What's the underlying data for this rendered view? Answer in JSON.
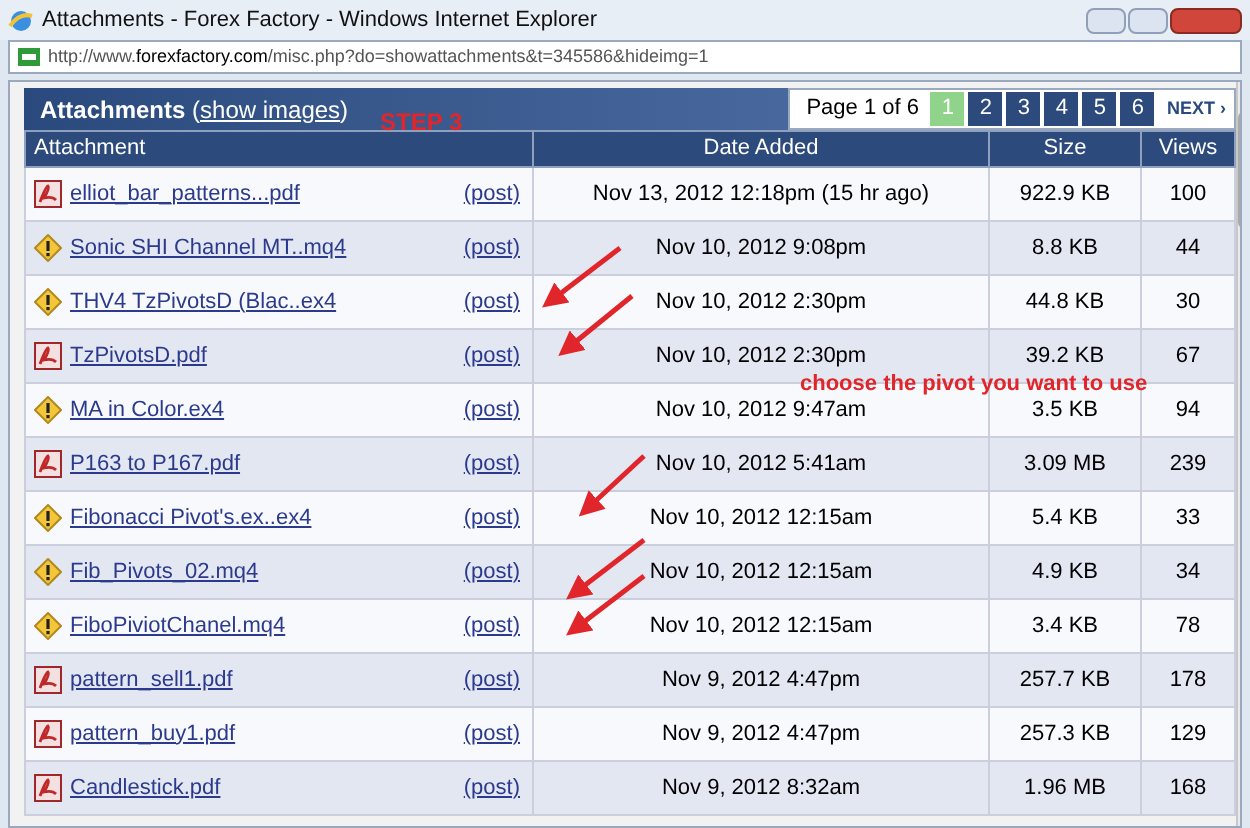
{
  "window": {
    "title": "Attachments - Forex Factory - Windows Internet Explorer"
  },
  "address_bar": {
    "prefix": "http://www.",
    "domain": "forexfactory.com",
    "path": "/misc.php?do=showattachments&t=345586&hideimg=1"
  },
  "header": {
    "title": "Attachments",
    "link_open": "(",
    "link": "show images",
    "link_close": ")"
  },
  "pagination": {
    "label": "Page 1 of 6",
    "pages": [
      {
        "label": "1",
        "selected": true
      },
      {
        "label": "2",
        "selected": false
      },
      {
        "label": "3",
        "selected": false
      },
      {
        "label": "4",
        "selected": false
      },
      {
        "label": "5",
        "selected": false
      },
      {
        "label": "6",
        "selected": false
      }
    ],
    "next": "NEXT ›"
  },
  "table": {
    "columns": [
      "Attachment",
      "Date Added",
      "Size",
      "Views"
    ],
    "rows": [
      {
        "kind": "pdf",
        "name": "elliot_bar_patterns...pdf",
        "post": "(post)",
        "date": "Nov 13, 2012 12:18pm (15 hr ago)",
        "size": "922.9 KB",
        "views": "100"
      },
      {
        "kind": "warning",
        "name": "Sonic SHI Channel MT..mq4",
        "post": "(post)",
        "date": "Nov 10, 2012 9:08pm",
        "size": "8.8 KB",
        "views": "44"
      },
      {
        "kind": "warning",
        "name": "THV4 TzPivotsD (Blac..ex4",
        "post": "(post)",
        "date": "Nov 10, 2012 2:30pm",
        "size": "44.8 KB",
        "views": "30"
      },
      {
        "kind": "pdf",
        "name": "TzPivotsD.pdf",
        "post": "(post)",
        "date": "Nov 10, 2012 2:30pm",
        "size": "39.2 KB",
        "views": "67"
      },
      {
        "kind": "warning",
        "name": "MA in Color.ex4",
        "post": "(post)",
        "date": "Nov 10, 2012 9:47am",
        "size": "3.5 KB",
        "views": "94"
      },
      {
        "kind": "pdf",
        "name": "P163 to P167.pdf",
        "post": "(post)",
        "date": "Nov 10, 2012 5:41am",
        "size": "3.09 MB",
        "views": "239"
      },
      {
        "kind": "warning",
        "name": "Fibonacci Pivot's.ex..ex4",
        "post": "(post)",
        "date": "Nov 10, 2012 12:15am",
        "size": "5.4 KB",
        "views": "33"
      },
      {
        "kind": "warning",
        "name": "Fib_Pivots_02.mq4",
        "post": "(post)",
        "date": "Nov 10, 2012 12:15am",
        "size": "4.9 KB",
        "views": "34"
      },
      {
        "kind": "warning",
        "name": "FiboPiviotChanel.mq4",
        "post": "(post)",
        "date": "Nov 10, 2012 12:15am",
        "size": "3.4 KB",
        "views": "78"
      },
      {
        "kind": "pdf",
        "name": "pattern_sell1.pdf",
        "post": "(post)",
        "date": "Nov 9, 2012 4:47pm",
        "size": "257.7 KB",
        "views": "178"
      },
      {
        "kind": "pdf",
        "name": "pattern_buy1.pdf",
        "post": "(post)",
        "date": "Nov 9, 2012 4:47pm",
        "size": "257.3 KB",
        "views": "129"
      },
      {
        "kind": "pdf",
        "name": "Candlestick.pdf",
        "post": "(post)",
        "date": "Nov 9, 2012 8:32am",
        "size": "1.96 MB",
        "views": "168"
      }
    ]
  },
  "annotations": {
    "step": "STEP 3",
    "note": "choose the pivot you want to use"
  }
}
